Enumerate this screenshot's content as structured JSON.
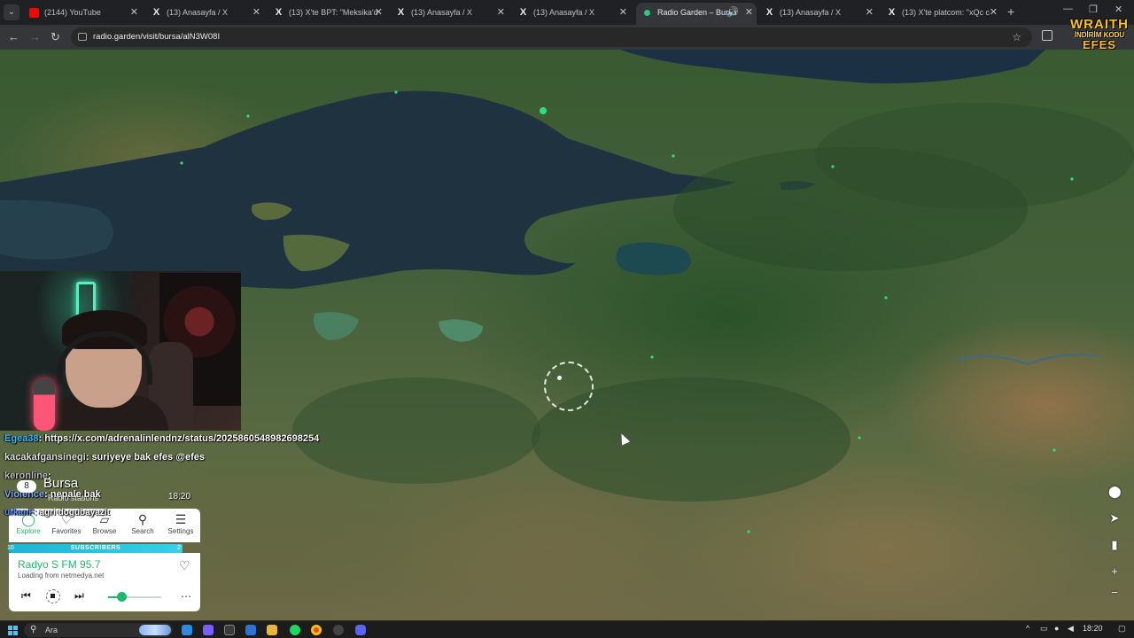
{
  "browser": {
    "tabs": [
      {
        "title": "(2144) YouTube",
        "icon": "youtube-icon",
        "active": false
      },
      {
        "title": "(13) Anasayfa / X",
        "icon": "x-icon",
        "active": false
      },
      {
        "title": "(13) X'te BPT: \"Meksika'd",
        "icon": "x-icon",
        "active": false
      },
      {
        "title": "(13) Anasayfa / X",
        "icon": "x-icon",
        "active": false
      },
      {
        "title": "(13) Anasayfa / X",
        "icon": "x-icon",
        "active": false
      },
      {
        "title": "Radio Garden – Bursa",
        "icon": "radio-garden-icon",
        "active": true
      },
      {
        "title": "(13) Anasayfa / X",
        "icon": "x-icon",
        "active": false
      },
      {
        "title": "(13) X'te platcom: \"xQc c",
        "icon": "x-icon",
        "active": false
      }
    ],
    "url": "radio.garden/visit/bursa/alN3W08I"
  },
  "overlay_ad": {
    "line1": "WRAITH",
    "line2": "İNDİRİM KODU",
    "line3": "EFES"
  },
  "chat": [
    {
      "user": "Egea38",
      "user_color": "#39b7ff",
      "message": ": https://x.com/adrenalinlendnz/status/2025860548982698254"
    },
    {
      "user": "kacakafgansinegi",
      "user_color": "#e0e0e0",
      "message": ": suriyeye bak efes @efes"
    },
    {
      "user": "keronline",
      "user_color": "#bbbbbb",
      "message": ":"
    },
    {
      "user": "Violence",
      "user_color": "#7fa8ff",
      "message": ": nepale bak"
    },
    {
      "user": "urkanF",
      "user_color": "#5a8cff",
      "message": ": agri dogubayazit"
    }
  ],
  "radio_garden": {
    "city": {
      "name": "Bursa",
      "station_count": "8",
      "subtitle": "Radio stations",
      "local_time": "18:20"
    },
    "nav": [
      {
        "label": "Explore",
        "icon": "explore-icon",
        "active": true
      },
      {
        "label": "Favorites",
        "icon": "heart-icon",
        "active": false
      },
      {
        "label": "Browse",
        "icon": "map-icon",
        "active": false
      },
      {
        "label": "Search",
        "icon": "search-icon",
        "active": false
      },
      {
        "label": "Settings",
        "icon": "menu-icon",
        "active": false
      }
    ],
    "subscribers_bar": {
      "label": "SUBSCRIBERS",
      "left": "10",
      "right": "2"
    },
    "player": {
      "station": "Radyo S FM 95.7",
      "status": "Loading from netmedya.net",
      "volume": 0.3
    }
  },
  "taskbar": {
    "search_placeholder": "Ara",
    "clock": "18:20"
  },
  "colors": {
    "accent": "#1fb86b",
    "tab_bar": "#202124",
    "toolbar": "#35363a"
  }
}
